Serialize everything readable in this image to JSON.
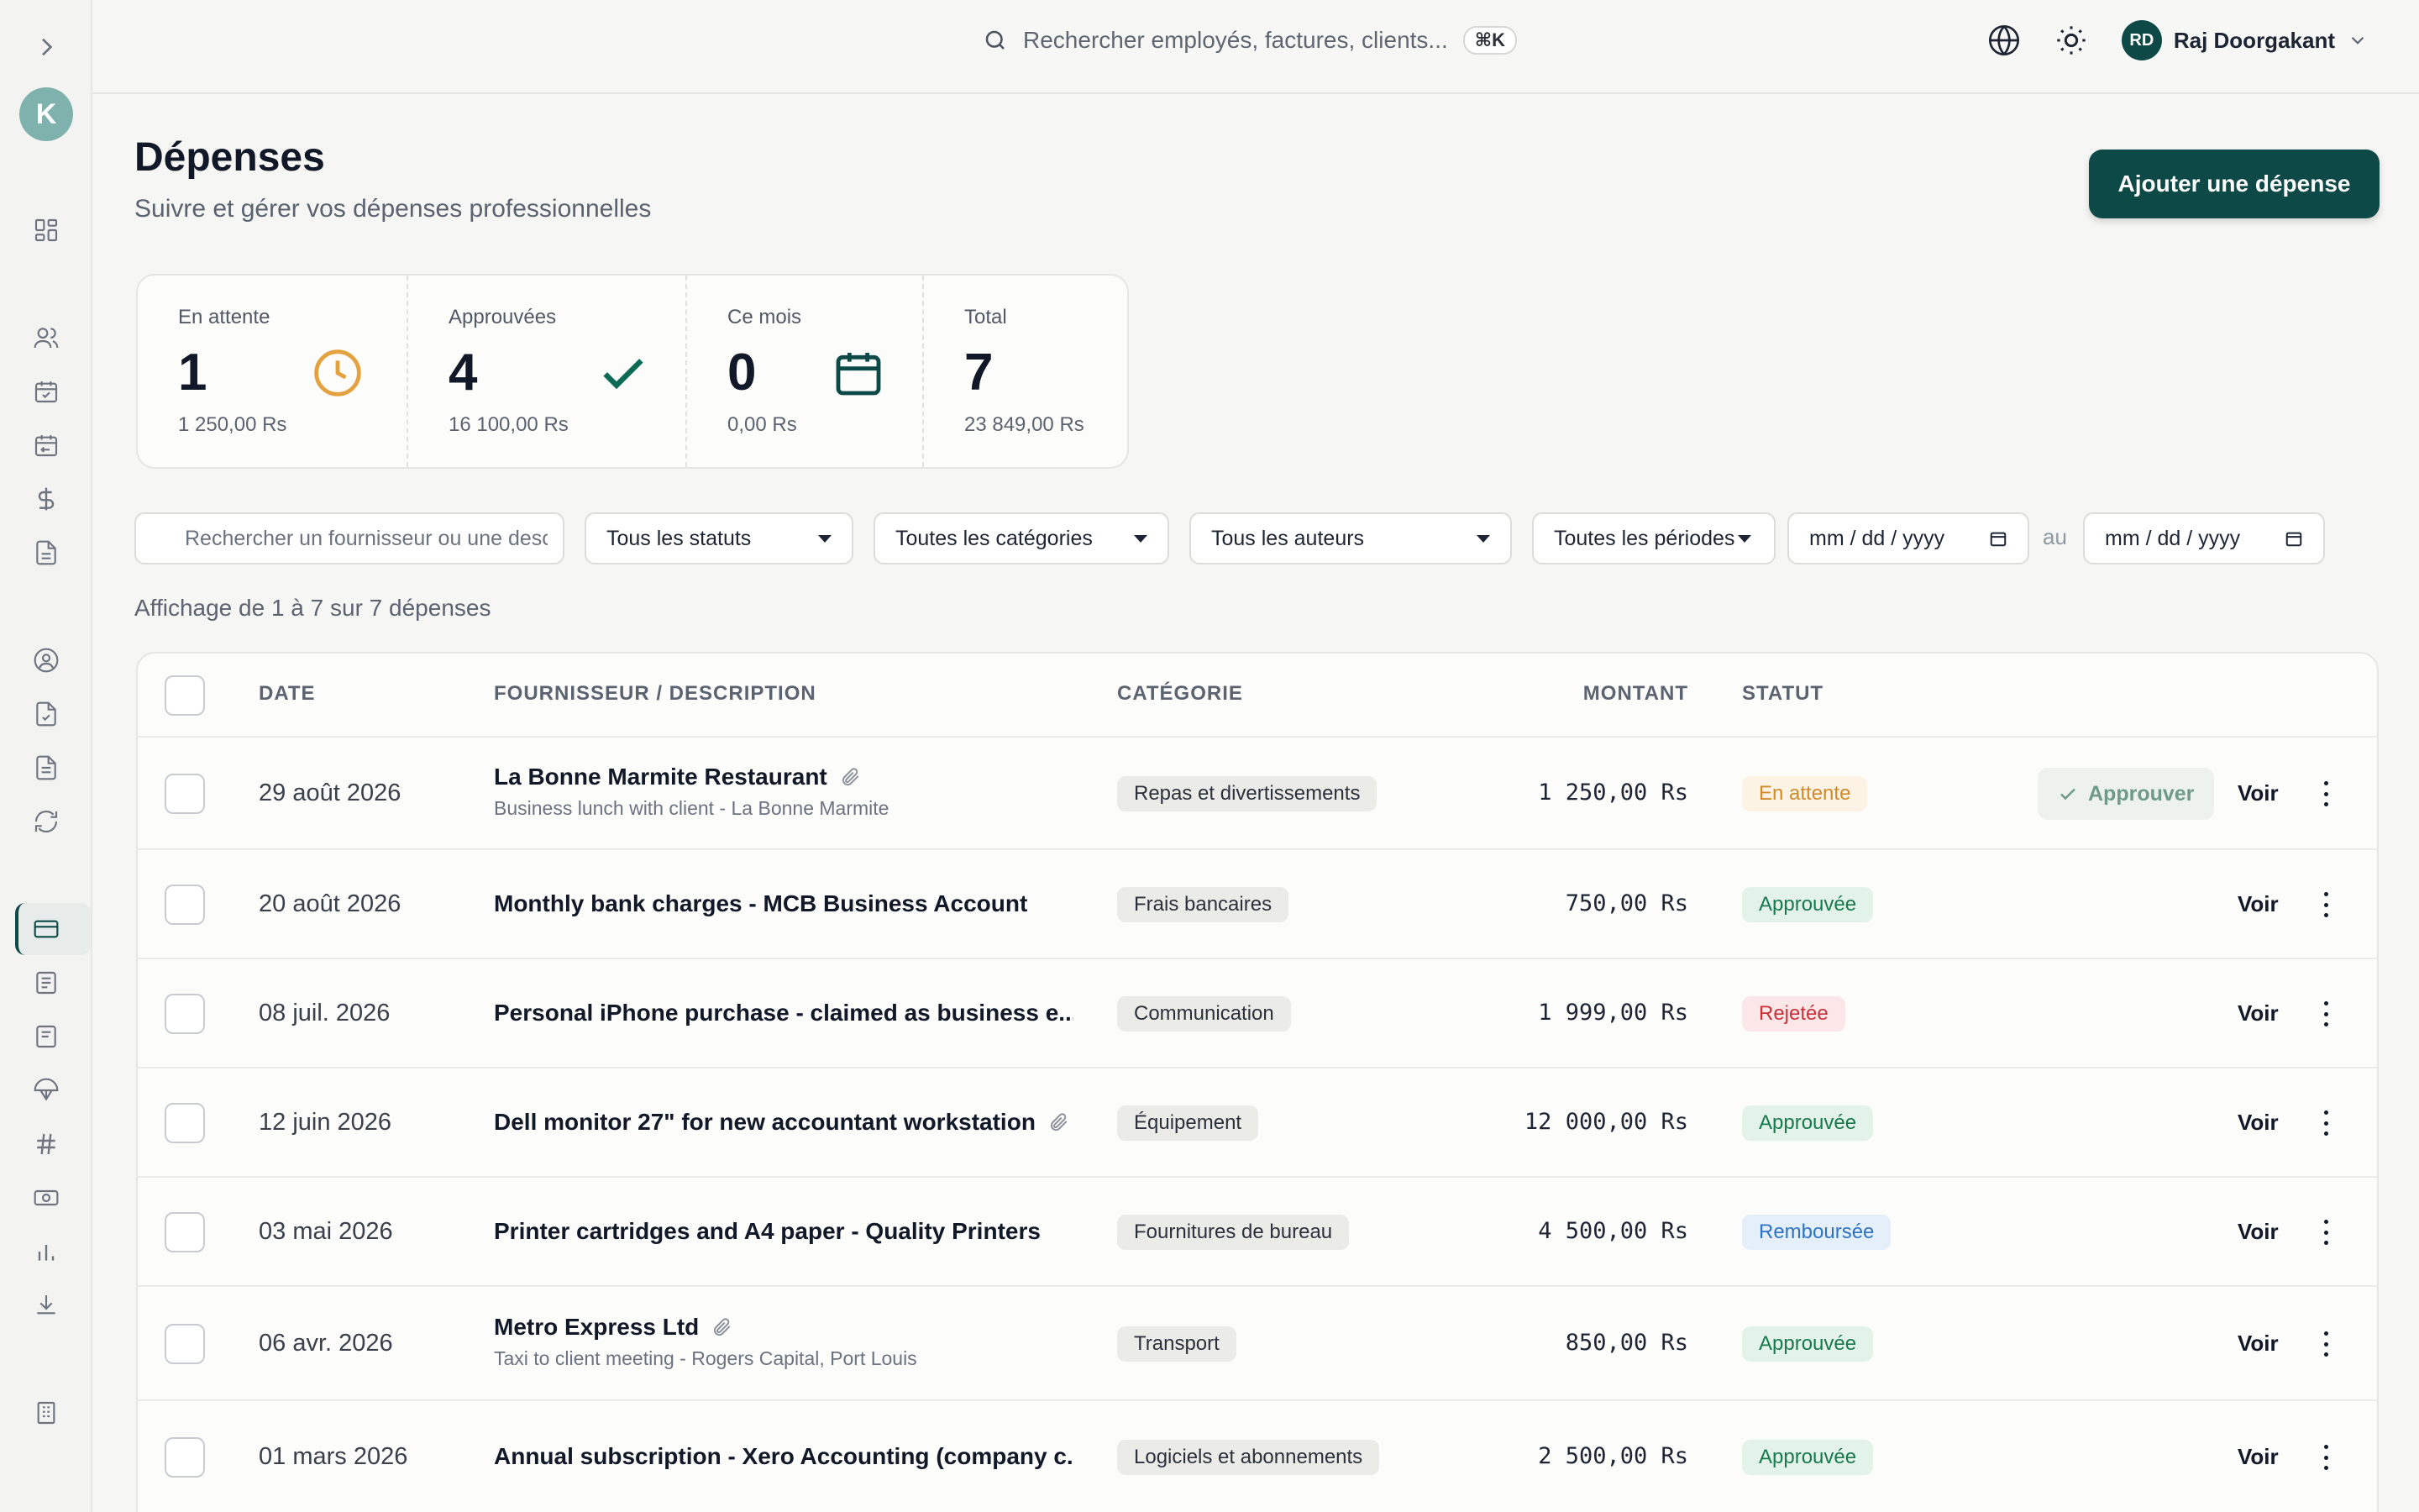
{
  "app": {
    "logo_letter": "K"
  },
  "topbar": {
    "search_placeholder": "Rechercher employés, factures, clients...",
    "shortcut": "⌘K",
    "user_initials": "RD",
    "user_name": "Raj Doorgakant"
  },
  "page": {
    "title": "Dépenses",
    "subtitle": "Suivre et gérer vos dépenses professionnelles",
    "add_button": "Ajouter une dépense"
  },
  "stats": [
    {
      "label": "En attente",
      "value": "1",
      "sub": "1 250,00 Rs",
      "icon": "clock-icon",
      "color": "#e3a23f"
    },
    {
      "label": "Approuvées",
      "value": "4",
      "sub": "16 100,00 Rs",
      "icon": "check-icon",
      "color": "#0d6b55"
    },
    {
      "label": "Ce mois",
      "value": "0",
      "sub": "0,00 Rs",
      "icon": "calendar-icon",
      "color": "#0d4a47"
    },
    {
      "label": "Total",
      "value": "7",
      "sub": "23 849,00 Rs",
      "icon": "",
      "color": ""
    }
  ],
  "filters": {
    "search_placeholder": "Rechercher un fournisseur ou une description",
    "status": "Tous les statuts",
    "category": "Toutes les catégories",
    "author": "Tous les auteurs",
    "period": "Toutes les périodes",
    "date_from": "mm / dd / yyyy",
    "date_to": "mm / dd / yyyy",
    "between": "au"
  },
  "showing": "Affichage de 1 à 7 sur 7 dépenses",
  "table": {
    "headers": {
      "date": "DATE",
      "vendor": "FOURNISSEUR / DESCRIPTION",
      "category": "CATÉGORIE",
      "amount": "MONTANT",
      "status": "STATUT"
    },
    "approve_label": "Approuver",
    "view_label": "Voir",
    "rows": [
      {
        "date": "29 août 2026",
        "vendor": "La Bonne Marmite Restaurant",
        "desc": "Business lunch with client - La Bonne Marmite",
        "category": "Repas et divertissements",
        "amount": "1 250,00 Rs",
        "status": "En attente",
        "status_fg": "#d08a2e",
        "status_bg": "#fcf3e4",
        "attachment": true
      },
      {
        "date": "20 août 2026",
        "vendor": "Monthly bank charges - MCB Business Account",
        "desc": "",
        "category": "Frais bancaires",
        "amount": "750,00 Rs",
        "status": "Approuvée",
        "status_fg": "#17794d",
        "status_bg": "#e4f3ea",
        "attachment": false
      },
      {
        "date": "08 juil. 2026",
        "vendor": "Personal iPhone purchase - claimed as business e...",
        "desc": "",
        "category": "Communication",
        "amount": "1 999,00 Rs",
        "status": "Rejetée",
        "status_fg": "#c8313a",
        "status_bg": "#fbe7e8",
        "attachment": false
      },
      {
        "date": "12 juin 2026",
        "vendor": "Dell monitor 27\" for new accountant workstation",
        "desc": "",
        "category": "Équipement",
        "amount": "12 000,00 Rs",
        "status": "Approuvée",
        "status_fg": "#17794d",
        "status_bg": "#e4f3ea",
        "attachment": true
      },
      {
        "date": "03 mai 2026",
        "vendor": "Printer cartridges and A4 paper - Quality Printers",
        "desc": "",
        "category": "Fournitures de bureau",
        "amount": "4 500,00 Rs",
        "status": "Remboursée",
        "status_fg": "#2f74c0",
        "status_bg": "#e5effa",
        "attachment": false
      },
      {
        "date": "06 avr. 2026",
        "vendor": "Metro Express Ltd",
        "desc": "Taxi to client meeting - Rogers Capital, Port Louis",
        "category": "Transport",
        "amount": "850,00 Rs",
        "status": "Approuvée",
        "status_fg": "#17794d",
        "status_bg": "#e4f3ea",
        "attachment": true
      },
      {
        "date": "01 mars 2026",
        "vendor": "Annual subscription - Xero Accounting (company c...",
        "desc": "",
        "category": "Logiciels et abonnements",
        "amount": "2 500,00 Rs",
        "status": "Approuvée",
        "status_fg": "#17794d",
        "status_bg": "#e4f3ea",
        "attachment": false
      }
    ]
  }
}
